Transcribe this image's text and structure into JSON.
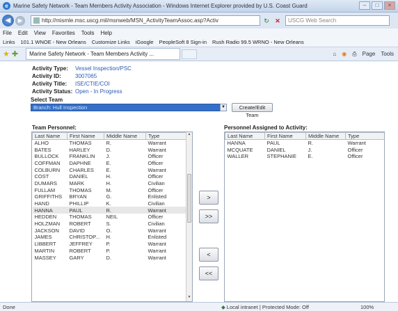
{
  "browser": {
    "window_title": "Marine Safety Network - Team Members Activity Association - Windows Internet Explorer provided by U.S. Coast Guard",
    "address": "http://mismle.msc.uscg.mil/msnweb/MSN_ActivityTeamAssoc.asp?Activ",
    "search_placeholder": "USCG Web Search",
    "menu": [
      "File",
      "Edit",
      "View",
      "Favorites",
      "Tools",
      "Help"
    ],
    "links_label": "Links",
    "links": [
      "101.1 WNOE - New Orleans",
      "Customize Links",
      "iGoogle",
      "PeopleSoft 8 Sign-in",
      "Rush Radio 99.5 WRNO - New Orleans"
    ],
    "tab_title": "Marine Safety Network - Team Members Activity ...",
    "commands": [
      "Page",
      "Tools"
    ],
    "status_left": "Done",
    "status_zone": "Local intranet | Protected Mode: Off",
    "zoom": "100%"
  },
  "activity": {
    "type_label": "Activity Type:",
    "type_value": "Vessel Inspection/PSC",
    "id_label": "Activity ID:",
    "id_value": "3007065",
    "title_label": "Activity Title:",
    "title_value": "ISE/CTIE/COI",
    "status_label": "Activity Status:",
    "status_value": "Open - In Progress"
  },
  "team_select": {
    "label": "Select Team",
    "selected": "Branch: Hull Inspection",
    "create_button": "Create/Edit Team"
  },
  "team_personnel": {
    "label": "Team Personnel:",
    "columns": [
      "Last Name",
      "First Name",
      "Middle Name",
      "Type"
    ],
    "rows": [
      [
        "ALHO",
        "THOMAS",
        "R.",
        "Warrant"
      ],
      [
        "BATES",
        "HARLEY",
        "D.",
        "Warrant"
      ],
      [
        "BULLOCK",
        "FRANKLIN",
        "J.",
        "Officer"
      ],
      [
        "COFFMAN",
        "DAPHNE",
        "E.",
        "Officer"
      ],
      [
        "COLBURN",
        "CHARLES",
        "E.",
        "Warrant"
      ],
      [
        "COST",
        "DANIEL",
        "H.",
        "Officer"
      ],
      [
        "DUMARS",
        "MARK",
        "H.",
        "Civilian"
      ],
      [
        "FULLAM",
        "THOMAS",
        "M.",
        "Officer"
      ],
      [
        "GRIFFITHS",
        "BRYAN",
        "G.",
        "Enlisted"
      ],
      [
        "HAND",
        "PHILLIP",
        "K.",
        "Civilian"
      ],
      [
        "HANNA",
        "PAUL",
        "R.",
        "Warrant"
      ],
      [
        "HEDDEN",
        "THOMAS",
        "NEIL",
        "Officer"
      ],
      [
        "HOLZMAN",
        "ROBERT",
        "S.",
        "Civilian"
      ],
      [
        "JACKSON",
        "DAVID",
        "O.",
        "Warrant"
      ],
      [
        "JAMES",
        "CHRISTOP...",
        "H.",
        "Enlisted"
      ],
      [
        "LIBBERT",
        "JEFFREY",
        "P.",
        "Warrant"
      ],
      [
        "MARTIN",
        "ROBERT",
        "P.",
        "Warrant"
      ],
      [
        "MASSEY",
        "GARY",
        "D.",
        "Warrant"
      ]
    ],
    "selected_index": 10
  },
  "assigned_personnel": {
    "label": "Personnel Assigned to Activity:",
    "columns": [
      "Last Name",
      "First Name",
      "Middle Name",
      "Type"
    ],
    "rows": [
      [
        "HANNA",
        "PAUL",
        "R.",
        "Warrant"
      ],
      [
        "MCQUATE",
        "DANIEL",
        "J.",
        "Officer"
      ],
      [
        "WALLER",
        "STEPHANIE",
        "E.",
        "Officer"
      ]
    ]
  },
  "move_buttons": {
    "add_one": ">",
    "add_all": ">>",
    "remove_one": "<",
    "remove_all": "<<"
  },
  "colors": {
    "link_blue": "#2b5bb5",
    "select_bg": "#3470c8"
  }
}
